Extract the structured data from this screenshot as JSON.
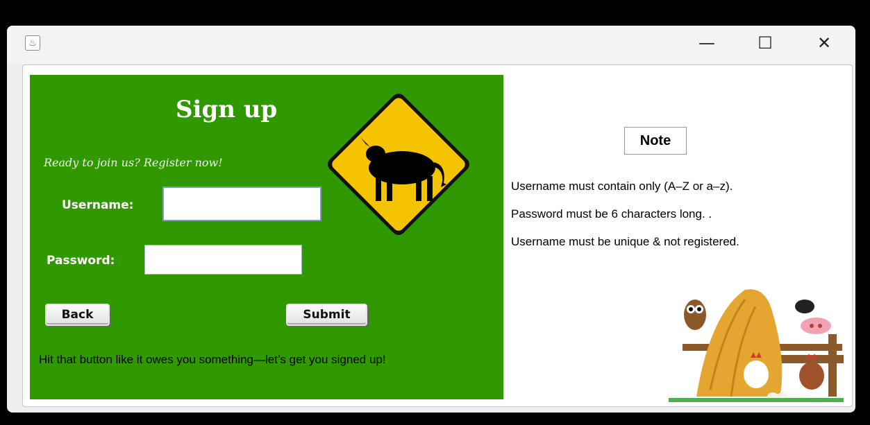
{
  "window": {
    "icon": "java-cup-icon",
    "controls": {
      "minimize": "—",
      "maximize": "☐",
      "close": "✕"
    }
  },
  "signup": {
    "title": "Sign up",
    "tagline": "Ready to join us? Register now!",
    "username_label": "Username:",
    "username_value": "",
    "password_label": "Password:",
    "password_value": "",
    "back_label": "Back",
    "submit_label": "Submit",
    "hint": "Hit that button like it owes you something—let’s get you signed up!"
  },
  "note": {
    "title": "Note",
    "rules": [
      "Username must contain only  (A–Z or a–z).",
      "Password must be 6 characters long. .",
      "Username must be unique & not registered."
    ]
  },
  "colors": {
    "panel_green": "#319900",
    "sign_yellow": "#f5c400"
  }
}
